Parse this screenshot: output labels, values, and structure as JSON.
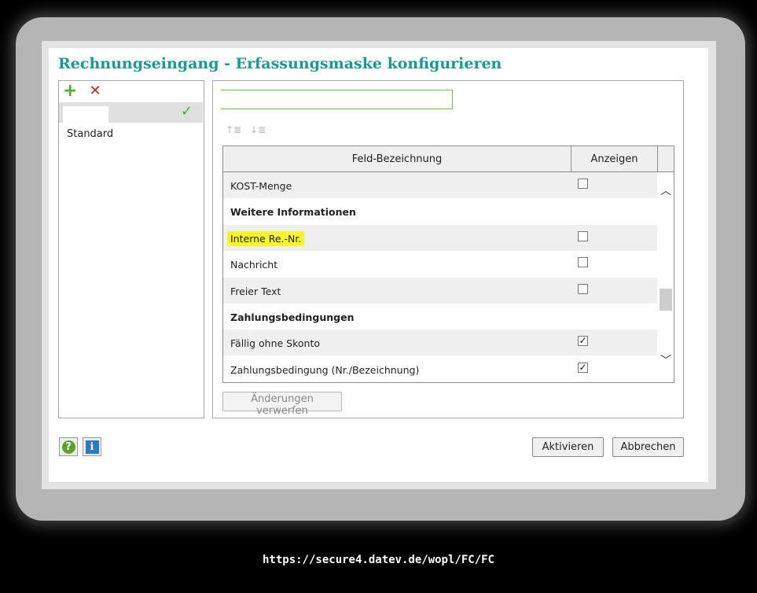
{
  "dialog": {
    "title": "Rechnungseingang - Erfassungsmaske konfigurieren"
  },
  "left_panel": {
    "add_icon": "plus-icon",
    "delete_icon": "x-icon",
    "selected_value": "",
    "profiles": [
      "Standard"
    ]
  },
  "right_panel": {
    "name_value": "",
    "table": {
      "headers": {
        "name": "Feld-Bezeichnung",
        "show": "Anzeigen"
      },
      "rows": [
        {
          "label": "KOST-Menge",
          "section": false,
          "checked": false,
          "has_checkbox": true
        },
        {
          "label": "Weitere Informationen",
          "section": true,
          "has_checkbox": false
        },
        {
          "label": "Interne Re.-Nr.",
          "section": false,
          "checked": false,
          "has_checkbox": true,
          "highlighted": true
        },
        {
          "label": "Nachricht",
          "section": false,
          "checked": false,
          "has_checkbox": true
        },
        {
          "label": "Freier Text",
          "section": false,
          "checked": false,
          "has_checkbox": true
        },
        {
          "label": "Zahlungsbedingungen",
          "section": true,
          "has_checkbox": false
        },
        {
          "label": "Fällig ohne Skonto",
          "section": false,
          "checked": true,
          "has_checkbox": true
        },
        {
          "label": "Zahlungsbedingung (Nr./Bezeichnung)",
          "section": false,
          "checked": true,
          "has_checkbox": true
        }
      ]
    },
    "discard_label": "Änderungen verwerfen"
  },
  "footer": {
    "activate_label": "Aktivieren",
    "cancel_label": "Abbrechen"
  },
  "url": "https://secure4.datev.de/wopl/FC/FC",
  "colors": {
    "title": "#1a9a8e",
    "highlight": "#f5f52a",
    "green": "#4caf1e",
    "red": "#d6202a"
  }
}
